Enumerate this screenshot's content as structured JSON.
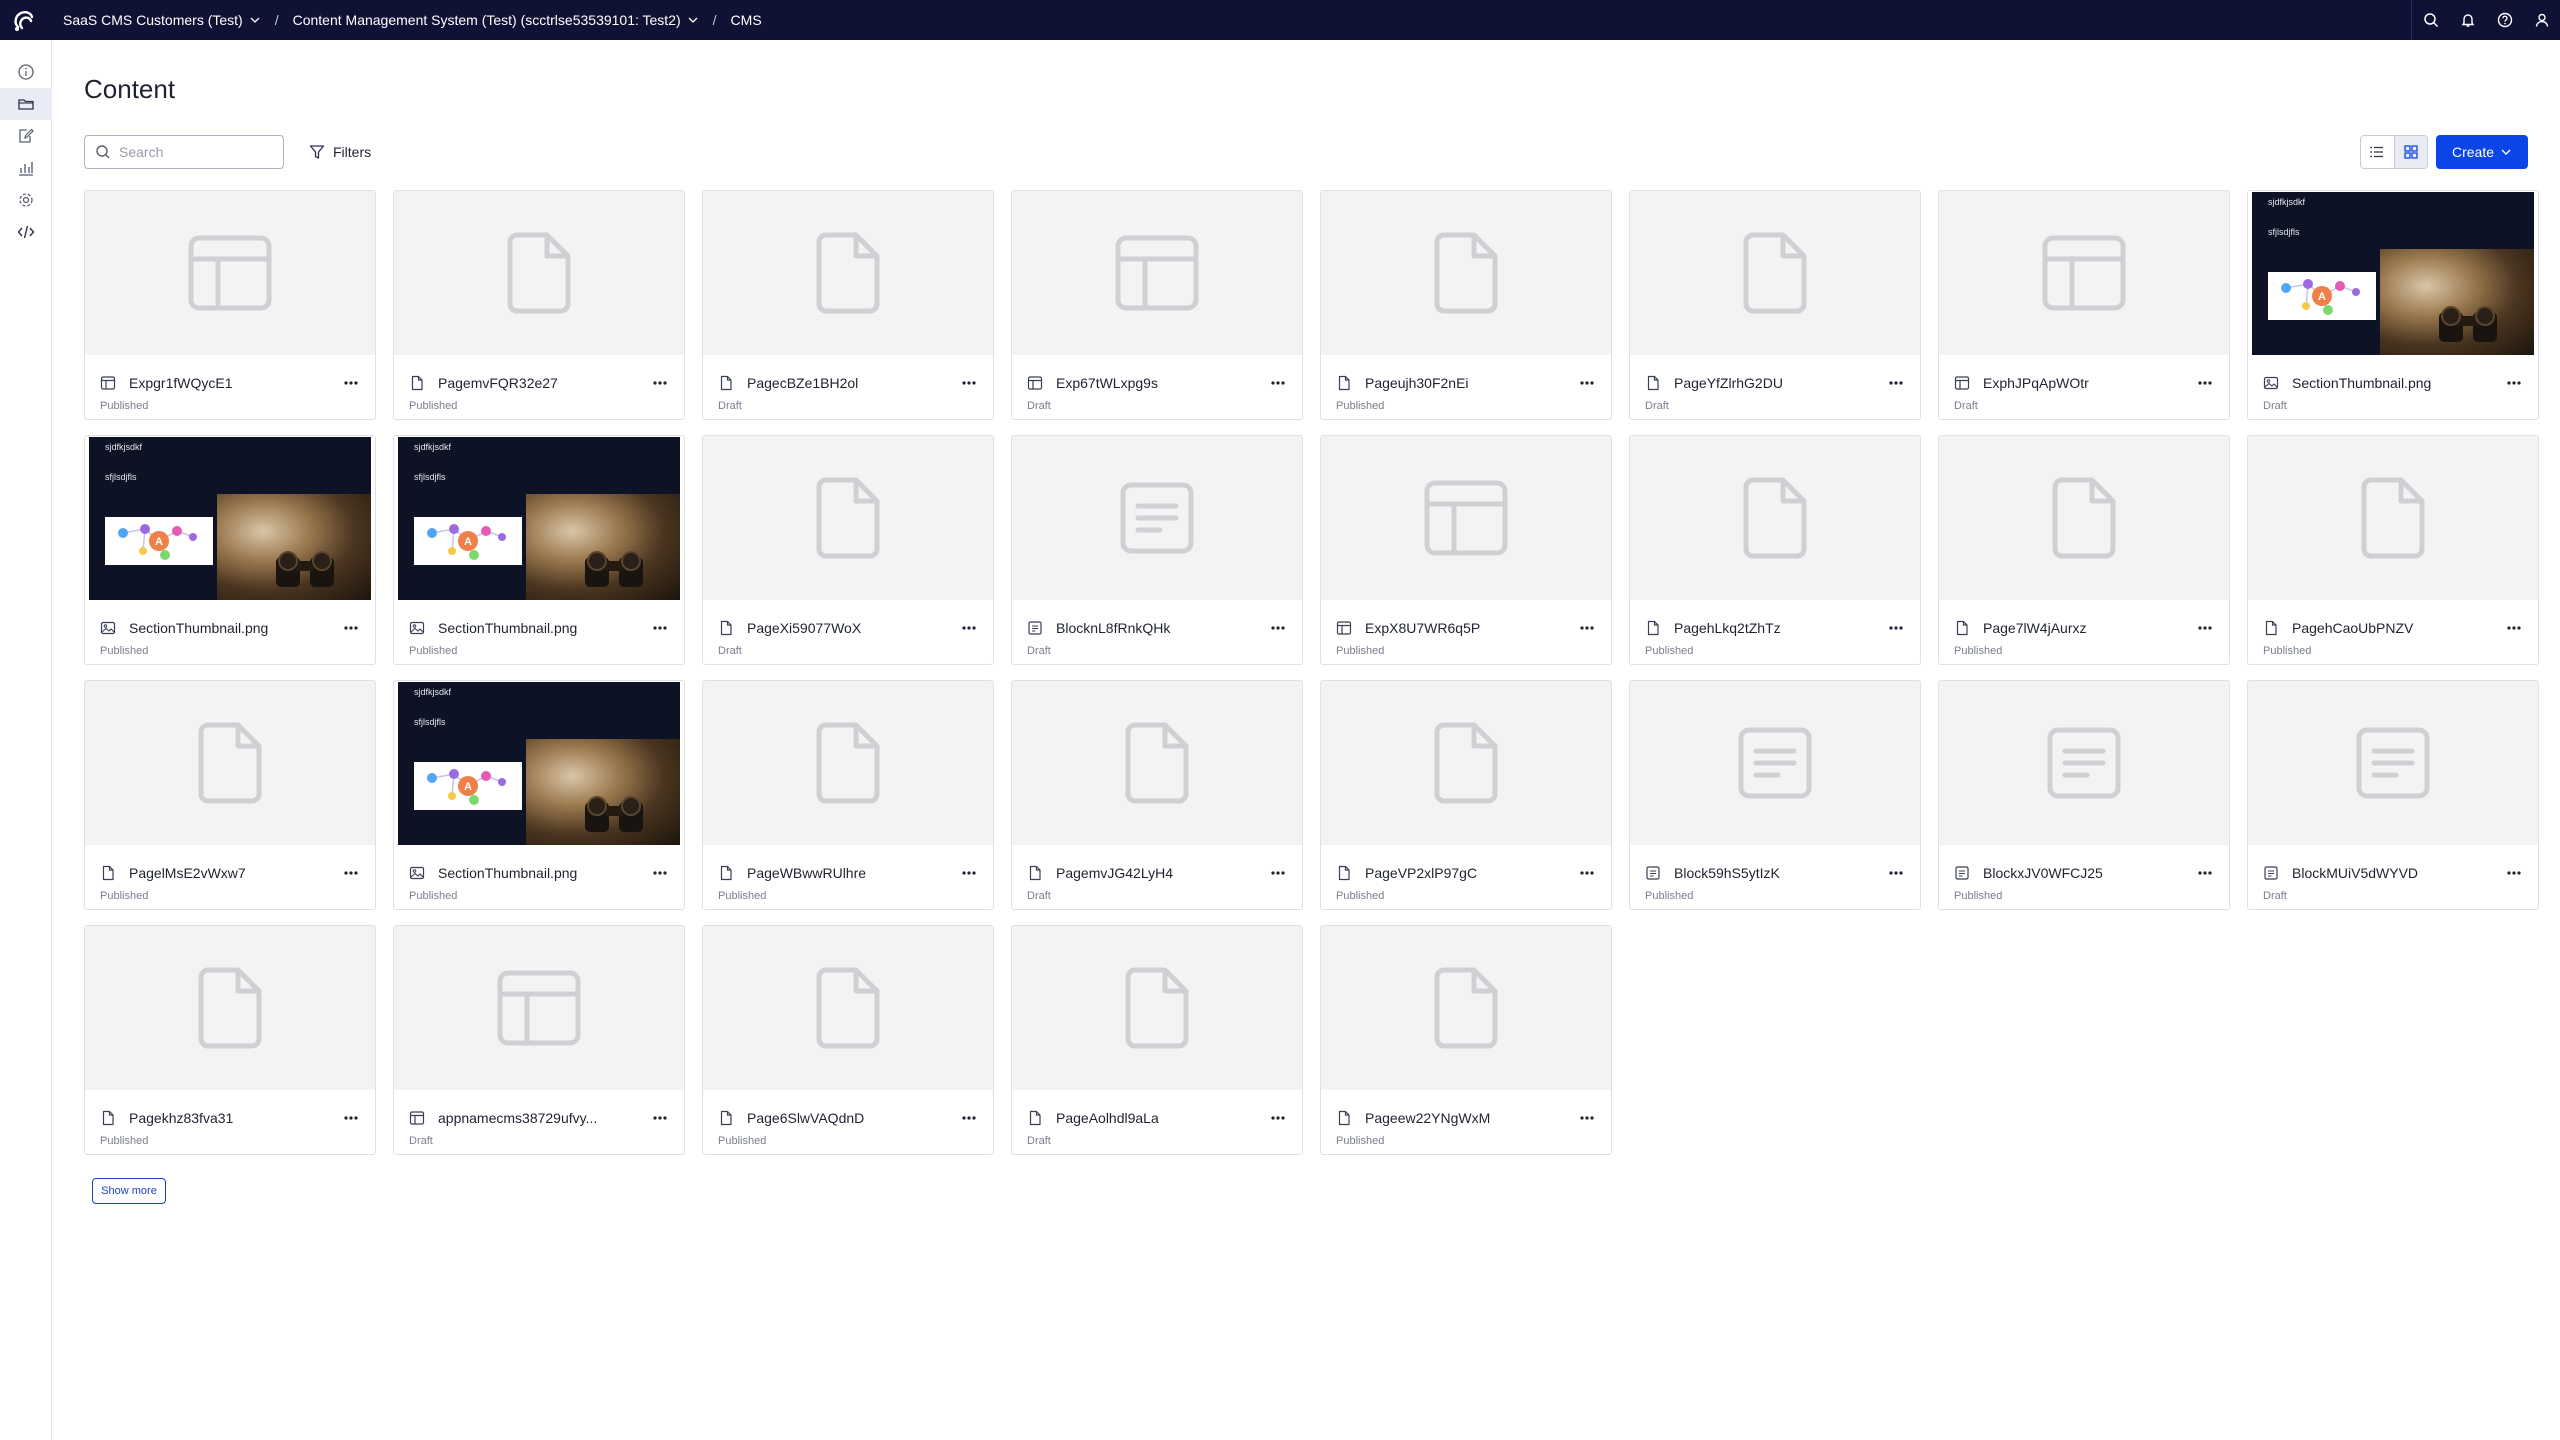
{
  "topbar": {
    "breadcrumbs": [
      {
        "label": "SaaS CMS Customers (Test)",
        "dropdown": true
      },
      {
        "label": "Content Management System (Test) (scctrlse53539101: Test2)",
        "dropdown": true
      },
      {
        "label": "CMS",
        "dropdown": false
      }
    ],
    "icons": [
      "search-icon",
      "bell-icon",
      "help-icon",
      "user-icon"
    ]
  },
  "rail": {
    "items": [
      "info-icon",
      "folder-icon",
      "edit-icon",
      "analytics-icon",
      "settings-icon",
      "code-icon"
    ],
    "active": "folder-icon"
  },
  "page": {
    "title": "Content",
    "search_placeholder": "Search",
    "filters_label": "Filters",
    "create_label": "Create",
    "show_more_label": "Show more"
  },
  "colors": {
    "topbar_bg": "#0f1235",
    "primary": "#0b45e8",
    "placeholder_bg": "#f3f3f4",
    "icon_placeholder": "#cfd0d4"
  },
  "cards": [
    {
      "name": "Expgr1fWQycE1",
      "status": "Published",
      "type": "experience",
      "thumb": "layout"
    },
    {
      "name": "PagemvFQR32e27",
      "status": "Published",
      "type": "page",
      "thumb": "page"
    },
    {
      "name": "PagecBZe1BH2ol",
      "status": "Draft",
      "type": "page",
      "thumb": "page"
    },
    {
      "name": "Exp67tWLxpg9s",
      "status": "Draft",
      "type": "experience",
      "thumb": "layout"
    },
    {
      "name": "Pageujh30F2nEi",
      "status": "Published",
      "type": "page",
      "thumb": "page"
    },
    {
      "name": "PageYfZlrhG2DU",
      "status": "Draft",
      "type": "page",
      "thumb": "page"
    },
    {
      "name": "ExphJPqApWOtr",
      "status": "Draft",
      "type": "experience",
      "thumb": "layout"
    },
    {
      "name": "SectionThumbnail.png",
      "status": "Draft",
      "type": "image",
      "thumb": "image"
    },
    {
      "name": "SectionThumbnail.png",
      "status": "Published",
      "type": "image",
      "thumb": "image"
    },
    {
      "name": "SectionThumbnail.png",
      "status": "Published",
      "type": "image",
      "thumb": "image"
    },
    {
      "name": "PageXi59077WoX",
      "status": "Draft",
      "type": "page",
      "thumb": "page"
    },
    {
      "name": "BlocknL8fRnkQHk",
      "status": "Draft",
      "type": "block",
      "thumb": "block"
    },
    {
      "name": "ExpX8U7WR6q5P",
      "status": "Published",
      "type": "experience",
      "thumb": "layout"
    },
    {
      "name": "PagehLkq2tZhTz",
      "status": "Published",
      "type": "page",
      "thumb": "page"
    },
    {
      "name": "Page7lW4jAurxz",
      "status": "Published",
      "type": "page",
      "thumb": "page"
    },
    {
      "name": "PagehCaoUbPNZV",
      "status": "Published",
      "type": "page",
      "thumb": "page"
    },
    {
      "name": "PagelMsE2vWxw7",
      "status": "Published",
      "type": "page",
      "thumb": "page"
    },
    {
      "name": "SectionThumbnail.png",
      "status": "Published",
      "type": "image",
      "thumb": "image"
    },
    {
      "name": "PageWBwwRUlhre",
      "status": "Published",
      "type": "page",
      "thumb": "page"
    },
    {
      "name": "PagemvJG42LyH4",
      "status": "Draft",
      "type": "page",
      "thumb": "page"
    },
    {
      "name": "PageVP2xlP97gC",
      "status": "Published",
      "type": "page",
      "thumb": "page"
    },
    {
      "name": "Block59hS5ytIzK",
      "status": "Published",
      "type": "block",
      "thumb": "block"
    },
    {
      "name": "BlockxJV0WFCJ25",
      "status": "Published",
      "type": "block",
      "thumb": "block"
    },
    {
      "name": "BlockMUiV5dWYVD",
      "status": "Draft",
      "type": "block",
      "thumb": "block"
    },
    {
      "name": "Pagekhz83fva31",
      "status": "Published",
      "type": "page",
      "thumb": "page"
    },
    {
      "name": "appnamecms38729ufvy...",
      "status": "Draft",
      "type": "experience",
      "thumb": "layout"
    },
    {
      "name": "Page6SlwVAQdnD",
      "status": "Published",
      "type": "page",
      "thumb": "page"
    },
    {
      "name": "PageAolhdl9aLa",
      "status": "Draft",
      "type": "page",
      "thumb": "page"
    },
    {
      "name": "Pageew22YNgWxM",
      "status": "Published",
      "type": "page",
      "thumb": "page"
    }
  ],
  "thumbnail_image": {
    "line1": "sjdfkjsdkf",
    "line2": "sfjlsdjfls"
  }
}
